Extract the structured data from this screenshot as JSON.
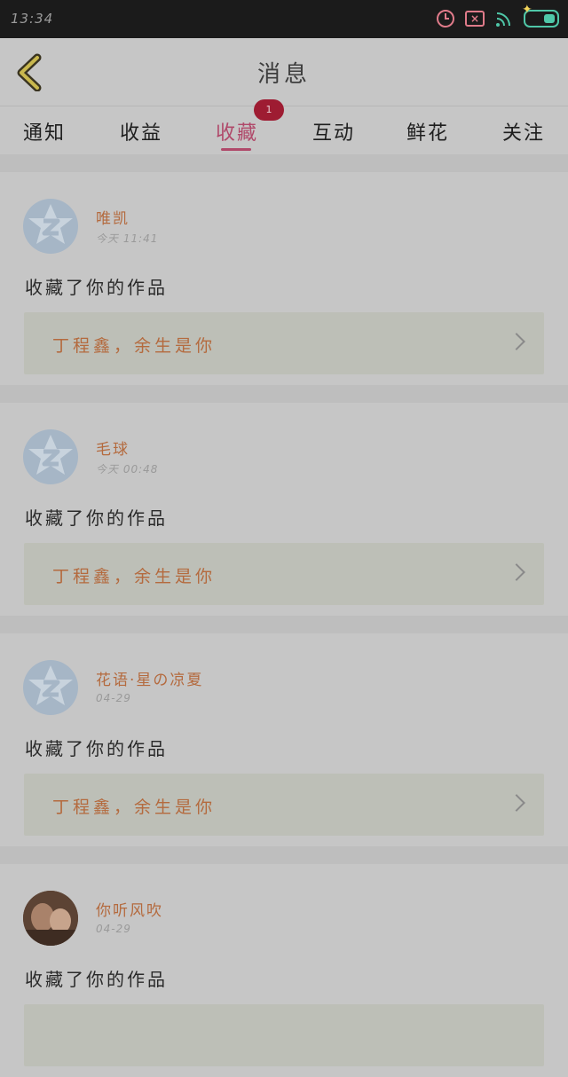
{
  "status": {
    "time": "13:34"
  },
  "header": {
    "title": "消息"
  },
  "tabs": [
    {
      "label": "通知"
    },
    {
      "label": "收益"
    },
    {
      "label": "收藏",
      "badge": "1"
    },
    {
      "label": "互动"
    },
    {
      "label": "鲜花"
    },
    {
      "label": "关注"
    }
  ],
  "items": [
    {
      "name": "唯凯",
      "time": "今天 11:41",
      "action": "收藏了你的作品",
      "work": "丁程鑫，余生是你"
    },
    {
      "name": "毛球",
      "time": "今天 00:48",
      "action": "收藏了你的作品",
      "work": "丁程鑫，余生是你"
    },
    {
      "name": "花语·星の凉夏",
      "time": "04-29",
      "action": "收藏了你的作品",
      "work": "丁程鑫，余生是你"
    },
    {
      "name": "你听风吹",
      "time": "04-29",
      "action": "收藏了你的作品"
    }
  ]
}
